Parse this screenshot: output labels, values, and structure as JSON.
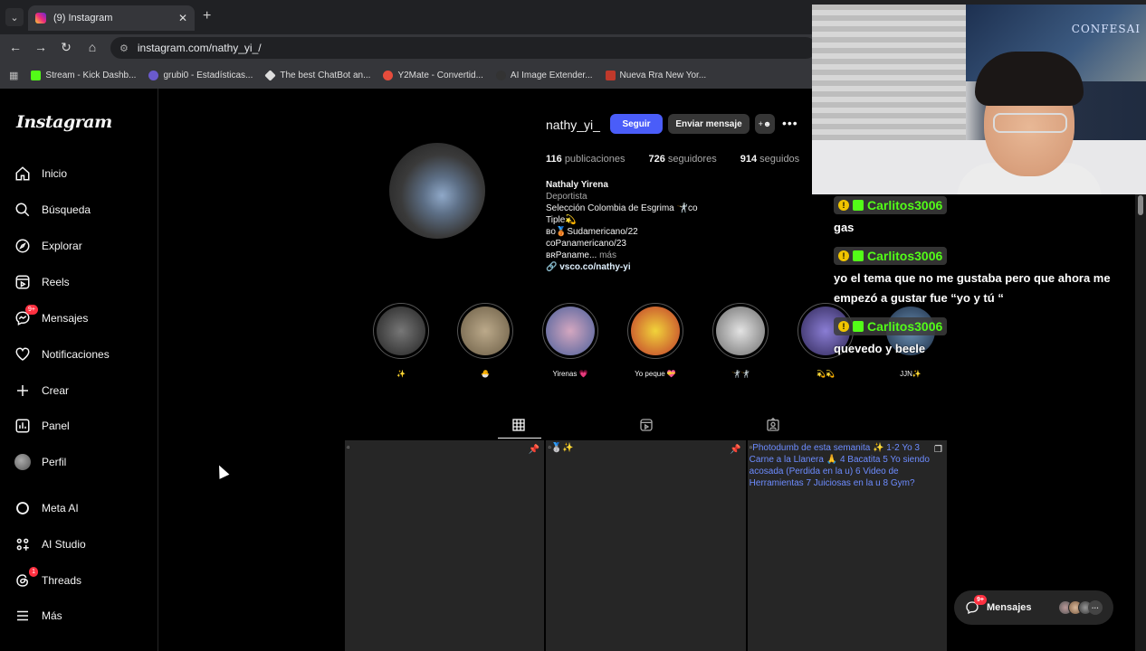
{
  "browser": {
    "tab_title": "(9) Instagram",
    "tab_close": "✕",
    "new_tab": "+",
    "url": "instagram.com/nathy_yi_/",
    "bookmarks": [
      {
        "label": "Stream - Kick Dashb...",
        "color": "#53fc18"
      },
      {
        "label": "grubi0 - Estadísticas...",
        "color": "#6a5acd"
      },
      {
        "label": "The best ChatBot an...",
        "color": "#dddddd"
      },
      {
        "label": "Y2Mate - Convertid...",
        "color": "#e74c3c"
      },
      {
        "label": "AI Image Extender...",
        "color": "#333333"
      },
      {
        "label": "Nueva Rra New Yor...",
        "color": "#c0392b"
      }
    ]
  },
  "sidebar": {
    "logo": "Instagram",
    "items": [
      {
        "label": "Inicio",
        "icon": "home-icon"
      },
      {
        "label": "Búsqueda",
        "icon": "search-icon"
      },
      {
        "label": "Explorar",
        "icon": "compass-icon"
      },
      {
        "label": "Reels",
        "icon": "reels-icon"
      },
      {
        "label": "Mensajes",
        "icon": "messenger-icon",
        "badge": "9+"
      },
      {
        "label": "Notificaciones",
        "icon": "heart-icon"
      },
      {
        "label": "Crear",
        "icon": "plus-icon"
      },
      {
        "label": "Panel",
        "icon": "chart-icon"
      },
      {
        "label": "Perfil",
        "icon": "avatar"
      },
      {
        "label": "Meta AI",
        "icon": "meta-ai-icon"
      },
      {
        "label": "AI Studio",
        "icon": "ai-studio-icon"
      },
      {
        "label": "Threads",
        "icon": "threads-icon",
        "badge": "1"
      },
      {
        "label": "Más",
        "icon": "menu-icon"
      }
    ]
  },
  "profile": {
    "username": "nathy_yi_",
    "follow_label": "Seguir",
    "message_label": "Enviar mensaje",
    "stats": {
      "posts": "116",
      "posts_label": "publicaciones",
      "followers": "726",
      "followers_label": "seguidores",
      "following": "914",
      "following_label": "seguidos"
    },
    "bio": {
      "name": "Nathaly Yirena",
      "category": "Deportista",
      "line1": "Selección Colombia de Esgrima 🤺co",
      "line2": "Tiple💫",
      "line3": "ʙᴏ🥉Sudamericano/22",
      "line4": "coPanamericano/23",
      "line5": "ʙʀPaname...",
      "more": "más",
      "link": "vsco.co/nathy-yi"
    },
    "highlights": [
      "✨",
      "🐣",
      "Yirenas 💗",
      "Yo peque 💝",
      "🤺🤺",
      "💫💫",
      "JJN✨"
    ]
  },
  "posts": [
    {
      "alt": ""
    },
    {
      "alt": "🥈✨"
    },
    {
      "alt": "Photodumb de esta semanita ✨ 1-2 Yo 3 Carne a la Llanera 🙏 4 Bacatita 5 Yo siendo acosada (Perdida en la u) 6 Video de Herramientas 7 Juiciosas en la u 8 Gym?"
    }
  ],
  "webcam": {
    "poster_text": "CONFESAI"
  },
  "chat": [
    {
      "user": "Carlitos3006",
      "message": "gas"
    },
    {
      "user": "Carlitos3006",
      "message": "yo el tema que no me gustaba pero que ahora me empezó a gustar fue “yo y tú “"
    },
    {
      "user": "Carlitos3006",
      "message": "quevedo y beele"
    }
  ],
  "messages_pill": {
    "label": "Mensajes",
    "badge": "9+"
  }
}
